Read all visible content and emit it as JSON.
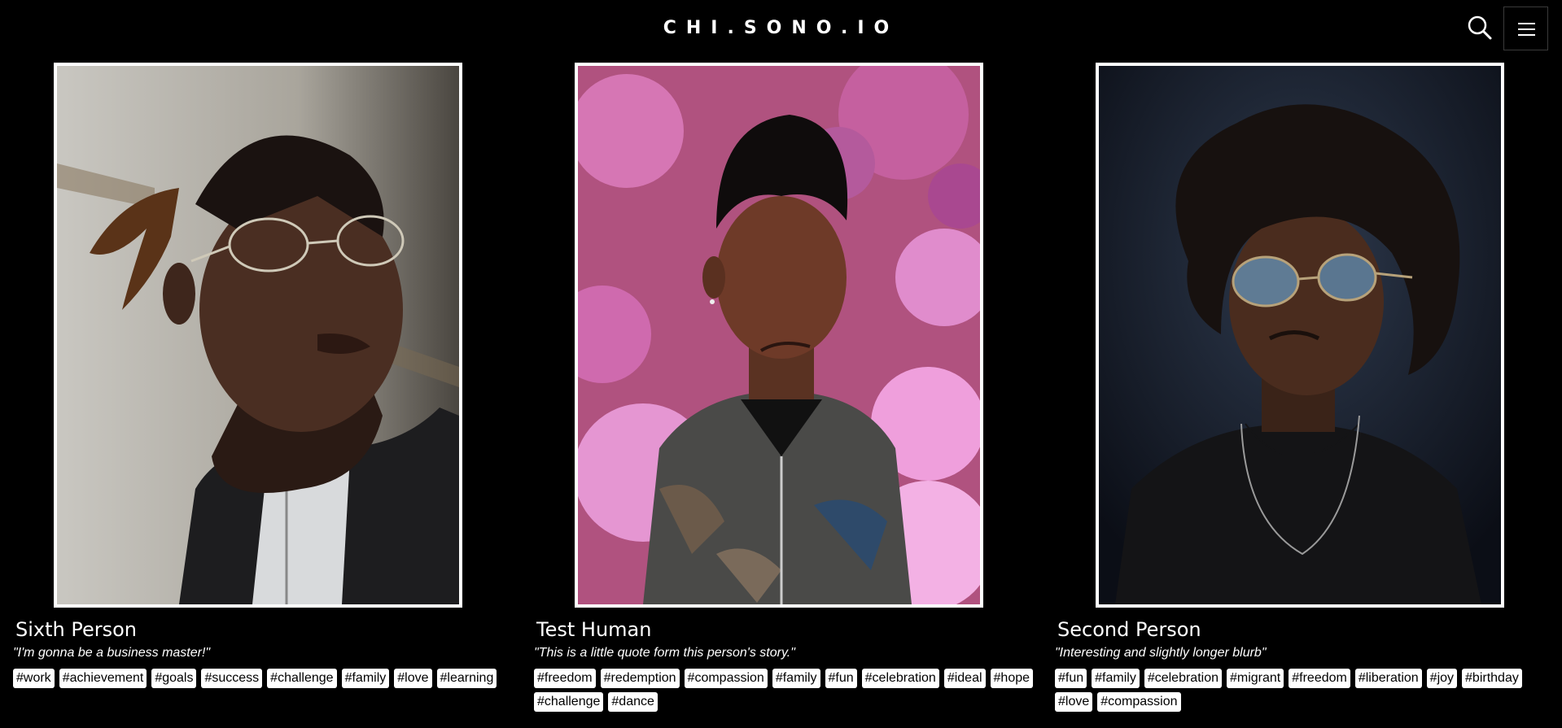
{
  "header": {
    "logo": "CHI.SONO.IO",
    "search_icon": "search-icon",
    "menu_icon": "hamburger-menu-icon"
  },
  "cards": [
    {
      "name": "Sixth Person",
      "quote": "\"I'm gonna be a business master!\"",
      "tags": [
        "#work",
        "#achievement",
        "#goals",
        "#success",
        "#challenge",
        "#family",
        "#love",
        "#learning"
      ]
    },
    {
      "name": "Test Human",
      "quote": "\"This is a little quote form this person's story.\"",
      "tags": [
        "#freedom",
        "#redemption",
        "#compassion",
        "#family",
        "#fun",
        "#celebration",
        "#ideal",
        "#hope",
        "#challenge",
        "#dance"
      ]
    },
    {
      "name": "Second Person",
      "quote": "\"Interesting and slightly longer blurb\"",
      "tags": [
        "#fun",
        "#family",
        "#celebration",
        "#migrant",
        "#freedom",
        "#liberation",
        "#joy",
        "#birthday",
        "#love",
        "#compassion"
      ]
    }
  ],
  "colors": {
    "background": "#000000",
    "frame": "#ffffff",
    "tag_bg": "#ffffff",
    "tag_text": "#000000"
  }
}
